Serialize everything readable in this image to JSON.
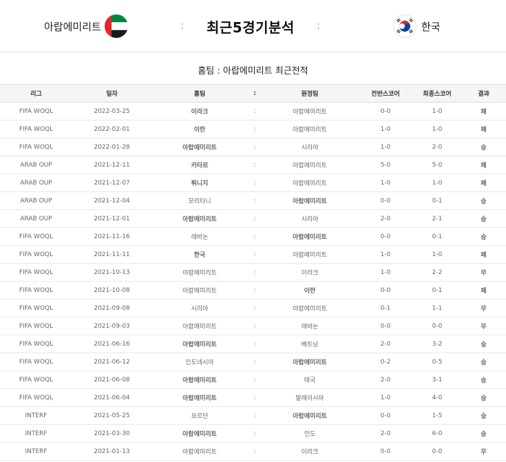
{
  "header": {
    "home_team": "아랍에미리트",
    "title": "최근5경기분석",
    "away_team": "한국",
    "separator": ":"
  },
  "subtitle": "홈팀 : 아랍에미리트 최근전적",
  "table": {
    "columns": [
      "리그",
      "일자",
      "홈팀",
      ":",
      "원정팀",
      "전반스코어",
      "최종스코어",
      "결과"
    ],
    "rows": [
      {
        "league": "FIFA WOQL",
        "date": "2022-03-25",
        "home": "이라크",
        "away": "아랍에미리트",
        "half": "0-0",
        "final": "1-0",
        "result": "패",
        "bold": "home"
      },
      {
        "league": "FIFA WOQL",
        "date": "2022-02-01",
        "home": "이란",
        "away": "아랍에미리트",
        "half": "1-0",
        "final": "1-0",
        "result": "패",
        "bold": "home"
      },
      {
        "league": "FIFA WOQL",
        "date": "2022-01-28",
        "home": "아랍에미리트",
        "away": "시리아",
        "half": "1-0",
        "final": "2-0",
        "result": "승",
        "bold": "home"
      },
      {
        "league": "ARAB OUP",
        "date": "2021-12-11",
        "home": "카타르",
        "away": "아랍에미리트",
        "half": "5-0",
        "final": "5-0",
        "result": "패",
        "bold": "home"
      },
      {
        "league": "ARAB OUP",
        "date": "2021-12-07",
        "home": "튀니지",
        "away": "아랍에미리트",
        "half": "1-0",
        "final": "1-0",
        "result": "패",
        "bold": "home"
      },
      {
        "league": "ARAB OUP",
        "date": "2021-12-04",
        "home": "모리타니",
        "away": "아랍에미리트",
        "half": "0-0",
        "final": "0-1",
        "result": "승",
        "bold": "away"
      },
      {
        "league": "ARAB OUP",
        "date": "2021-12-01",
        "home": "아랍에미리트",
        "away": "시리아",
        "half": "2-0",
        "final": "2-1",
        "result": "승",
        "bold": "home"
      },
      {
        "league": "FIFA WOQL",
        "date": "2021-11-16",
        "home": "레바논",
        "away": "아랍에미리트",
        "half": "0-0",
        "final": "0-1",
        "result": "승",
        "bold": "away"
      },
      {
        "league": "FIFA WOQL",
        "date": "2021-11-11",
        "home": "한국",
        "away": "아랍에미리트",
        "half": "1-0",
        "final": "1-0",
        "result": "패",
        "bold": "home"
      },
      {
        "league": "FIFA WOQL",
        "date": "2021-10-13",
        "home": "아랍에미리트",
        "away": "이라크",
        "half": "1-0",
        "final": "2-2",
        "result": "무",
        "bold": ""
      },
      {
        "league": "FIFA WOQL",
        "date": "2021-10-08",
        "home": "아랍에미리트",
        "away": "이란",
        "half": "0-0",
        "final": "0-1",
        "result": "패",
        "bold": "away"
      },
      {
        "league": "FIFA WOQL",
        "date": "2021-09-08",
        "home": "시리아",
        "away": "아랍에미리트",
        "half": "0-1",
        "final": "1-1",
        "result": "무",
        "bold": ""
      },
      {
        "league": "FIFA WOQL",
        "date": "2021-09-03",
        "home": "아랍에미리트",
        "away": "레바논",
        "half": "0-0",
        "final": "0-0",
        "result": "무",
        "bold": ""
      },
      {
        "league": "FIFA WOQL",
        "date": "2021-06-16",
        "home": "아랍에미리트",
        "away": "베트남",
        "half": "2-0",
        "final": "3-2",
        "result": "승",
        "bold": "home"
      },
      {
        "league": "FIFA WOQL",
        "date": "2021-06-12",
        "home": "인도네시아",
        "away": "아랍에미리트",
        "half": "0-2",
        "final": "0-5",
        "result": "승",
        "bold": "away"
      },
      {
        "league": "FIFA WOQL",
        "date": "2021-06-08",
        "home": "아랍에미리트",
        "away": "태국",
        "half": "2-0",
        "final": "3-1",
        "result": "승",
        "bold": "home"
      },
      {
        "league": "FIFA WOQL",
        "date": "2021-06-04",
        "home": "아랍에미리트",
        "away": "말레이시아",
        "half": "1-0",
        "final": "4-0",
        "result": "승",
        "bold": "home"
      },
      {
        "league": "INTERF",
        "date": "2021-05-25",
        "home": "요르단",
        "away": "아랍에미리트",
        "half": "0-0",
        "final": "1-5",
        "result": "승",
        "bold": "away"
      },
      {
        "league": "INTERF",
        "date": "2021-03-30",
        "home": "아랍에미리트",
        "away": "인도",
        "half": "2-0",
        "final": "6-0",
        "result": "승",
        "bold": "home"
      },
      {
        "league": "INTERF",
        "date": "2021-01-13",
        "home": "아랍에미리트",
        "away": "이라크",
        "half": "0-0",
        "final": "0-0",
        "result": "무",
        "bold": ""
      }
    ]
  },
  "colors": {
    "loss": "#1e5bd6",
    "win": "#d6262b",
    "draw": "#555555",
    "highlight_team": "#2f3a8f"
  },
  "icons": {
    "home_flag": "uae-flag-icon",
    "away_flag": "south-korea-flag-icon"
  }
}
